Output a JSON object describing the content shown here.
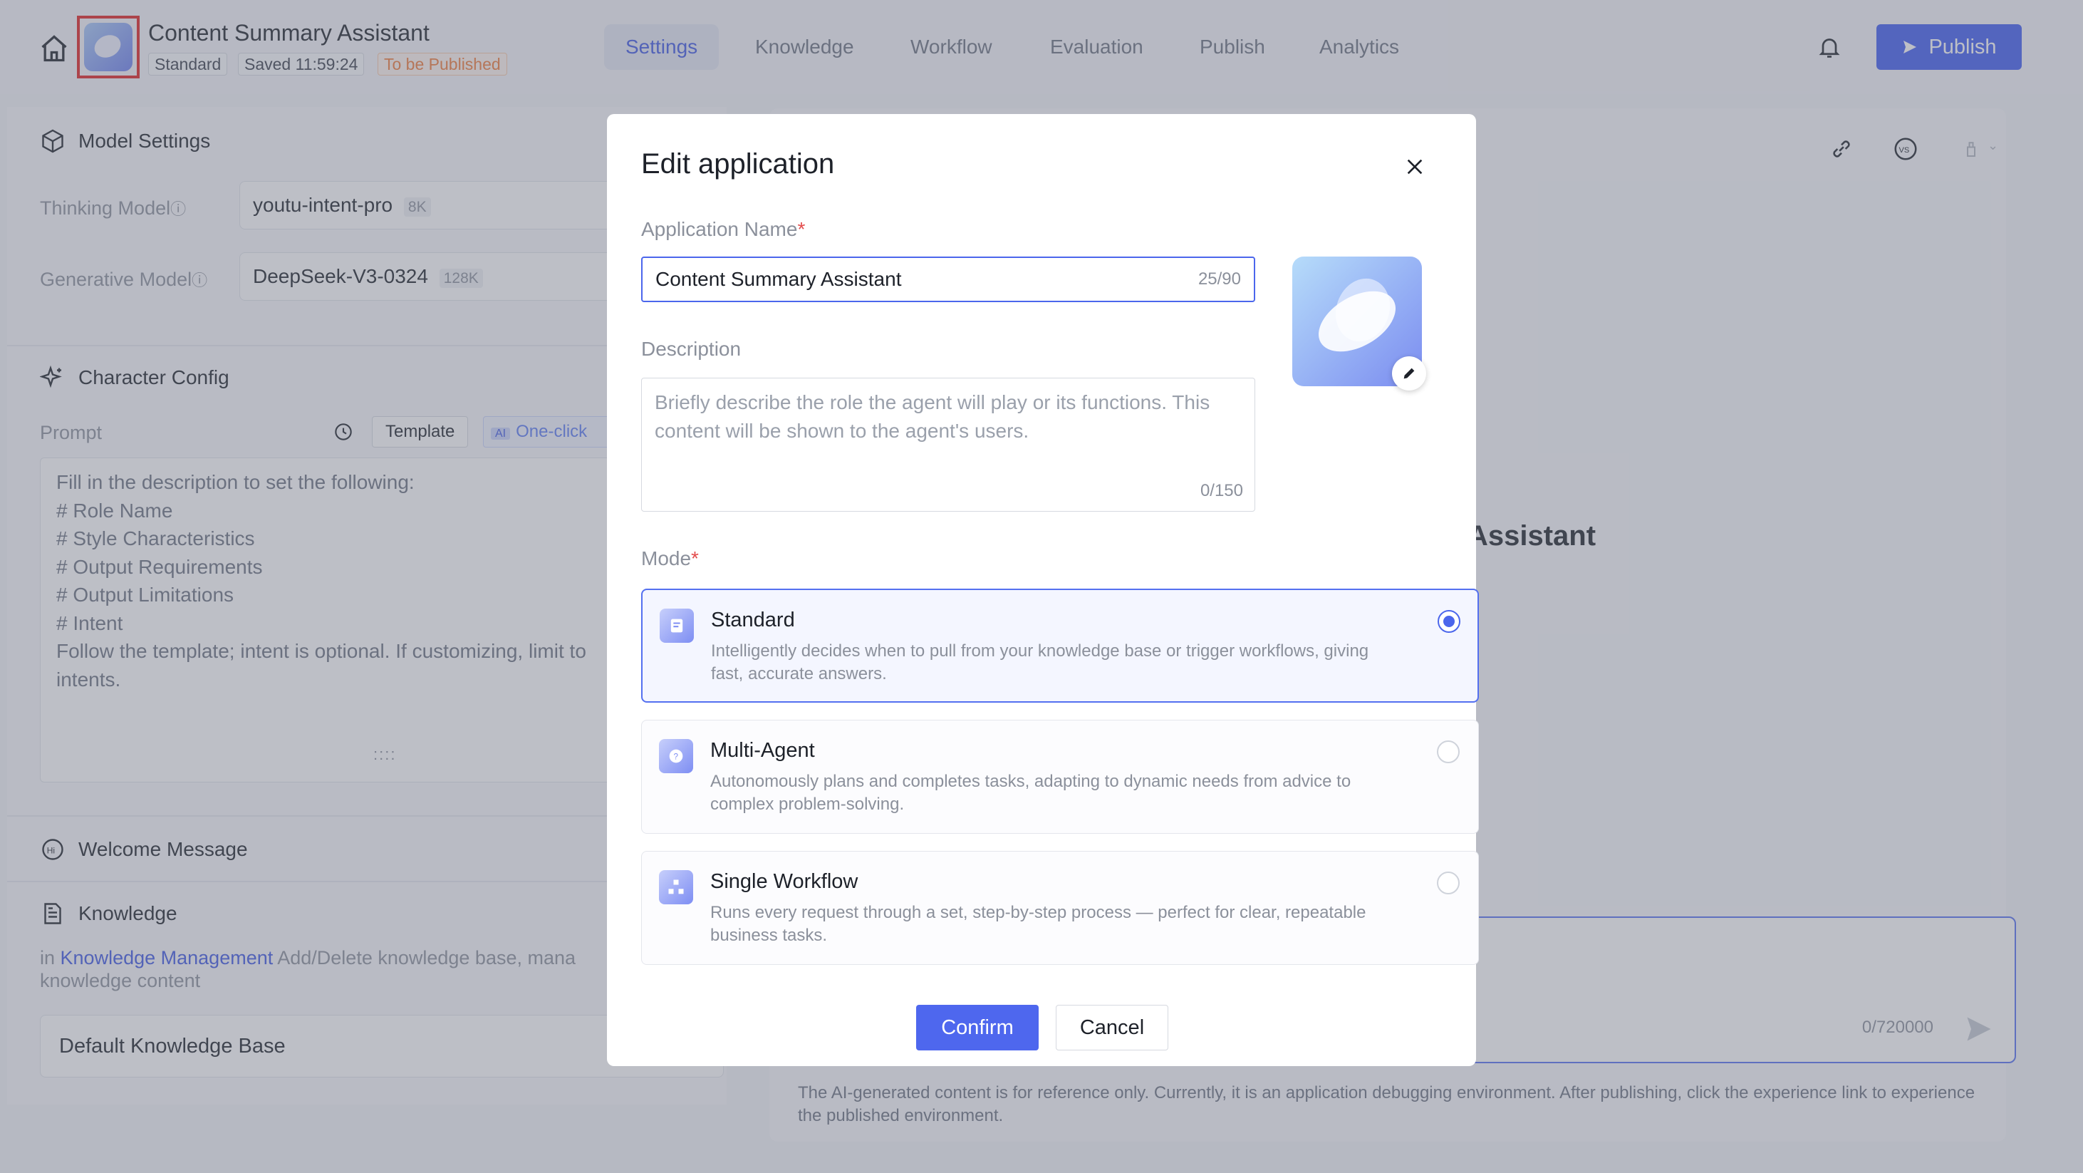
{
  "header": {
    "app_title": "Content Summary Assistant",
    "tags": [
      "Standard",
      "Saved 11:59:24",
      "To be Published"
    ],
    "tabs": [
      "Settings",
      "Knowledge",
      "Workflow",
      "Evaluation",
      "Publish",
      "Analytics"
    ],
    "active_tab": "Settings",
    "publish_label": "Publish"
  },
  "left": {
    "model_settings_title": "Model Settings",
    "thinking_model_label": "Thinking Model",
    "thinking_model_value": "youtu-intent-pro",
    "thinking_model_ctx": "8K",
    "generative_model_label": "Generative Model",
    "generative_model_value": "DeepSeek-V3-0324",
    "generative_model_ctx": "128K",
    "character_config_title": "Character Config",
    "prompt_label": "Prompt",
    "template_label": "Template",
    "oneclick_label": "One-click",
    "prompt_lines": [
      "Fill in the description to set the following:",
      "# Role Name",
      "# Style Characteristics",
      "# Output Requirements",
      "# Output Limitations",
      "# Intent",
      "Follow the template; intent is optional. If customizing, limit to",
      "intents."
    ],
    "welcome_title": "Welcome Message",
    "knowledge_title": "Knowledge",
    "knowledge_hint_prefix": "in ",
    "knowledge_hint_link": "Knowledge Management",
    "knowledge_hint_suffix": " Add/Delete knowledge base, mana",
    "knowledge_hint_line2": "knowledge content",
    "default_kb": "Default Knowledge Base"
  },
  "right": {
    "title_fragment": "Assistant",
    "input_counter": "0/720000",
    "disclaimer": "The AI-generated content is for reference only. Currently, it is an application debugging environment. After publishing, click the experience link to experience the published environment."
  },
  "modal": {
    "title": "Edit application",
    "name_label": "Application Name",
    "name_value": "Content Summary Assistant",
    "name_counter": "25/90",
    "description_label": "Description",
    "description_placeholder": "Briefly describe the role the agent will play or its functions. This content will be shown to the agent's users.",
    "description_counter": "0/150",
    "mode_label": "Mode",
    "modes": [
      {
        "title": "Standard",
        "desc": "Intelligently decides when to pull from your knowledge base or trigger workflows, giving fast, accurate answers.",
        "selected": true
      },
      {
        "title": "Multi-Agent",
        "desc": "Autonomously plans and completes tasks, adapting to dynamic needs from advice to complex problem-solving.",
        "selected": false
      },
      {
        "title": "Single Workflow",
        "desc": "Runs every request through a set, step-by-step process — perfect for clear, repeatable business tasks.",
        "selected": false
      }
    ],
    "confirm_label": "Confirm",
    "cancel_label": "Cancel"
  },
  "colors": {
    "accent": "#3f5bf0",
    "selected_border": "#5470f0",
    "warn": "#f07a3a",
    "required": "#e34d4d"
  }
}
